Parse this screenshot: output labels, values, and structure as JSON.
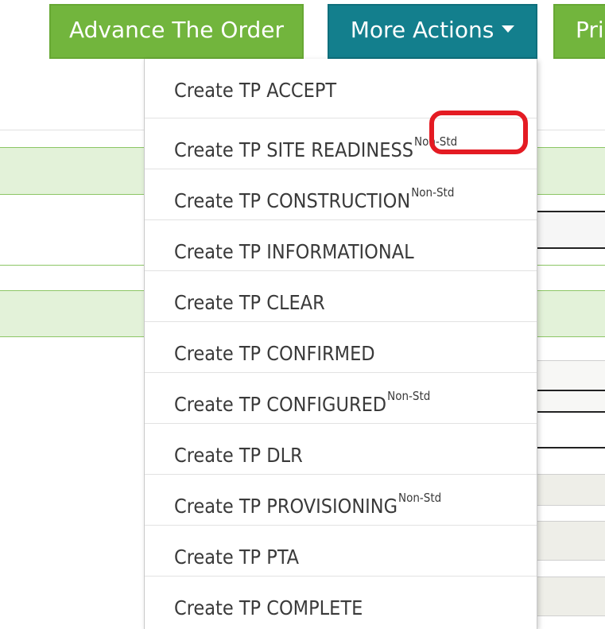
{
  "toolbar": {
    "advance_label": "Advance The Order",
    "more_actions_label": "More Actions",
    "more_actions_icon": "caret-down-icon",
    "print_label": "Pri"
  },
  "colors": {
    "green_button": "#72b53d",
    "teal_button": "#137f8d",
    "highlight_red": "#e41b23",
    "row_green": "#e3f2d9",
    "row_grey": "#eeeee8"
  },
  "menu": {
    "items": [
      {
        "label": "Create TP ACCEPT",
        "tag": ""
      },
      {
        "label": "Create TP SITE READINESS",
        "tag": "Non-Std"
      },
      {
        "label": "Create TP CONSTRUCTION",
        "tag": "Non-Std"
      },
      {
        "label": "Create TP INFORMATIONAL",
        "tag": ""
      },
      {
        "label": "Create TP CLEAR",
        "tag": ""
      },
      {
        "label": "Create TP CONFIRMED",
        "tag": ""
      },
      {
        "label": "Create TP CONFIGURED",
        "tag": "Non-Std"
      },
      {
        "label": "Create TP DLR",
        "tag": ""
      },
      {
        "label": "Create TP PROVISIONING",
        "tag": "Non-Std"
      },
      {
        "label": "Create TP PTA",
        "tag": ""
      },
      {
        "label": "Create TP COMPLETE",
        "tag": ""
      }
    ]
  }
}
